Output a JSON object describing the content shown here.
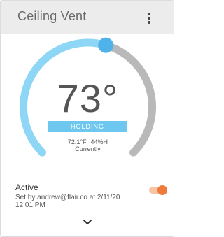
{
  "header": {
    "title": "Ceiling Vent",
    "menu_icon": "more-vert-icon"
  },
  "thermostat": {
    "temperature": "73°",
    "mode_label": "HOLDING",
    "current_temp": "72.1°F",
    "current_humidity": "44%H",
    "current_label": "Currently",
    "setpoint_fraction": 0.56,
    "colors": {
      "active_arc": "#8dd6f5",
      "inactive_arc": "#b9b9b9",
      "knob": "#4fb3ea",
      "badge": "#6ec7ef"
    }
  },
  "status": {
    "state": "Active",
    "set_by": "Set by andrew@flair.co at 2/11/20 12:01 PM",
    "toggle_on": true,
    "toggle_color": "#ee7a3c",
    "expand_icon": "chevron-down-icon"
  }
}
